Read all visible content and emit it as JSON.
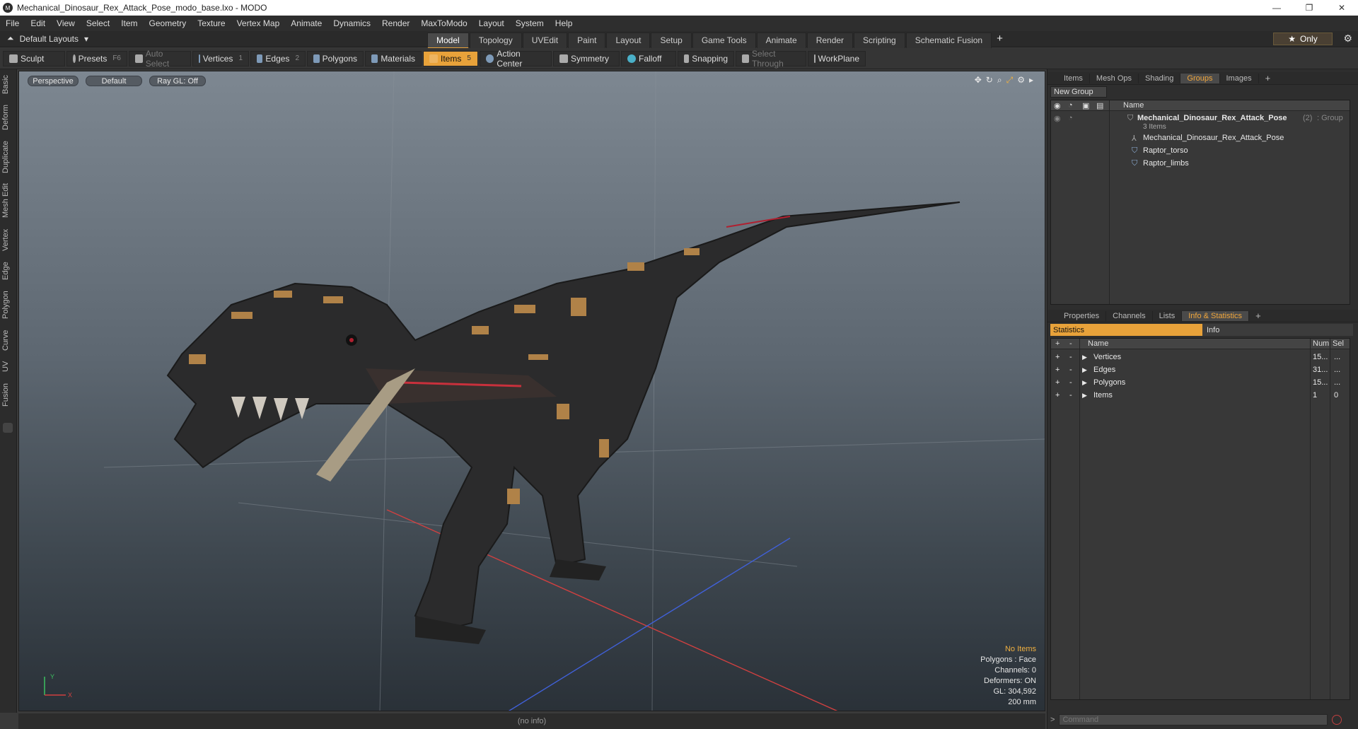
{
  "window": {
    "title": "Mechanical_Dinosaur_Rex_Attack_Pose_modo_base.lxo - MODO",
    "app_icon": "modo-icon"
  },
  "menu": [
    "File",
    "Edit",
    "View",
    "Select",
    "Item",
    "Geometry",
    "Texture",
    "Vertex Map",
    "Animate",
    "Dynamics",
    "Render",
    "MaxToModo",
    "Layout",
    "System",
    "Help"
  ],
  "layout_bar": {
    "preset": "Default Layouts",
    "tabs": [
      "Model",
      "Topology",
      "UVEdit",
      "Paint",
      "Layout",
      "Setup",
      "Game Tools",
      "Animate",
      "Render",
      "Scripting",
      "Schematic Fusion"
    ],
    "active_tab": "Model",
    "only_label": "Only"
  },
  "toolbar": {
    "sculpt": "Sculpt",
    "presets": "Presets",
    "presets_key": "F6",
    "auto_select": "Auto Select",
    "vertices": "Vertices",
    "vertices_key": "1",
    "edges": "Edges",
    "edges_key": "2",
    "polygons": "Polygons",
    "materials": "Materials",
    "items": "Items",
    "items_key": "5",
    "action_center": "Action Center",
    "symmetry": "Symmetry",
    "falloff": "Falloff",
    "snapping": "Snapping",
    "select_through": "Select Through",
    "workplane": "WorkPlane"
  },
  "left_tabs": [
    "Basic",
    "Deform",
    "Duplicate",
    "Mesh Edit",
    "Vertex",
    "Edge",
    "Polygon",
    "Curve",
    "UV",
    "Fusion"
  ],
  "viewport": {
    "view": "Perspective",
    "shading": "Default",
    "raygl": "Ray GL: Off",
    "hud": {
      "selection": "No Items",
      "polygons": "Polygons : Face",
      "channels": "Channels: 0",
      "deformers": "Deformers: ON",
      "gl": "GL: 304,592",
      "scale": "200 mm"
    },
    "axis_y": "Y",
    "axis_x": "X",
    "status": "(no info)"
  },
  "groups_panel": {
    "tabs": [
      "Items",
      "Mesh Ops",
      "Shading",
      "Groups",
      "Images"
    ],
    "active_tab": "Groups",
    "new_group": "New Group",
    "name_header": "Name",
    "group_name": "Mechanical_Dinosaur_Rex_Attack_Pose",
    "group_count": "(2)",
    "group_type": ": Group",
    "group_sub": "3 Items",
    "children": [
      "Mechanical_Dinosaur_Rex_Attack_Pose",
      "Raptor_torso",
      "Raptor_limbs"
    ]
  },
  "stats_panel": {
    "tabs": [
      "Properties",
      "Channels",
      "Lists",
      "Info & Statistics"
    ],
    "active_tab": "Info & Statistics",
    "statistics_btn": "Statistics",
    "info_btn": "Info",
    "headers": {
      "name": "Name",
      "num": "Num",
      "sel": "Sel"
    },
    "rows": [
      {
        "name": "Vertices",
        "num": "15...",
        "sel": "..."
      },
      {
        "name": "Edges",
        "num": "31...",
        "sel": "..."
      },
      {
        "name": "Polygons",
        "num": "15...",
        "sel": "..."
      },
      {
        "name": "Items",
        "num": "1",
        "sel": "0"
      }
    ]
  },
  "command": {
    "placeholder": "Command",
    "prompt": ">"
  },
  "colors": {
    "accent": "#e8a23a",
    "panel": "#2e2e2e"
  }
}
